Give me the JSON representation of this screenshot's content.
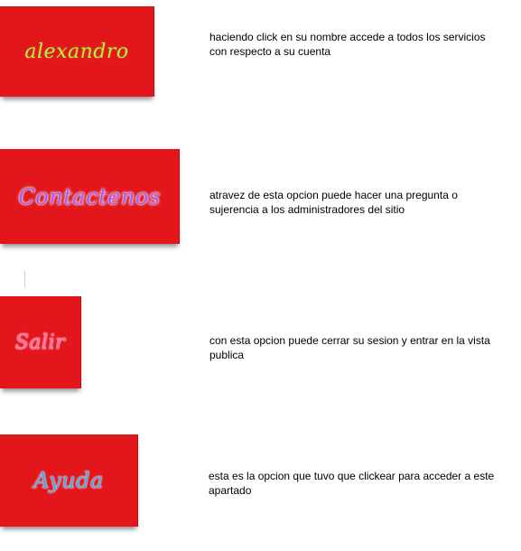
{
  "items": [
    {
      "button_label": "alexandro",
      "description": "haciendo click en su nombre accede a todos los servicios con respecto a su cuenta"
    },
    {
      "button_label": "Contactenos",
      "description": "atravez de esta opcion puede hacer una pregunta o sujerencia a los administradores del sitio"
    },
    {
      "button_label": "Salir",
      "description": "con esta opcion puede cerrar su sesion y entrar en la vista publica"
    },
    {
      "button_label": "Ayuda",
      "description": "esta es la opcion que  tuvo que clickear para acceder a este apartado"
    }
  ],
  "colors": {
    "button_background": "#e3171b",
    "alexandro_text": "#b7f03a",
    "contactenos_text": "#9a5cff",
    "salir_text": "#ff6aa0",
    "ayuda_text": "#48a6e6"
  }
}
